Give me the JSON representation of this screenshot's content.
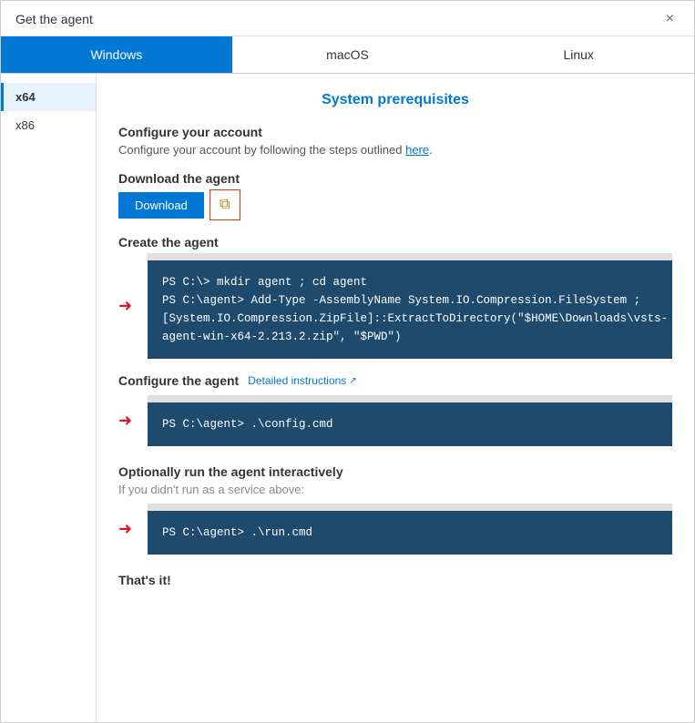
{
  "dialog": {
    "title": "Get the agent",
    "close_label": "×"
  },
  "os_tabs": [
    {
      "id": "windows",
      "label": "Windows",
      "active": true
    },
    {
      "id": "macos",
      "label": "macOS",
      "active": false
    },
    {
      "id": "linux",
      "label": "Linux",
      "active": false
    }
  ],
  "sidebar": {
    "items": [
      {
        "id": "x64",
        "label": "x64",
        "active": true
      },
      {
        "id": "x86",
        "label": "x86",
        "active": false
      }
    ]
  },
  "main": {
    "section_title": "System prerequisites",
    "configure_account": {
      "title": "Configure your account",
      "desc_prefix": "Configure your account by following the steps outlined ",
      "link_text": "here",
      "desc_suffix": "."
    },
    "download_agent": {
      "title": "Download the agent",
      "download_button": "Download",
      "copy_button_aria": "Copy download link"
    },
    "create_agent": {
      "title": "Create the agent",
      "code": "PS C:\\> mkdir agent ; cd agent\nPS C:\\agent> Add-Type -AssemblyName System.IO.Compression.FileSystem ;\n[System.IO.Compression.ZipFile]::ExtractToDirectory(\"$HOME\\Downloads\\vsts-\nagent-win-x64-2.213.2.zip\", \"$PWD\")"
    },
    "configure_agent": {
      "title": "Configure the agent",
      "detailed_link": "Detailed instructions",
      "detailed_link_icon": "↗",
      "code": "PS C:\\agent> .\\config.cmd"
    },
    "run_agent": {
      "title": "Optionally run the agent interactively",
      "desc": "If you didn't run as a service above:",
      "code": "PS C:\\agent> .\\run.cmd"
    },
    "thats_it": "That's it!"
  }
}
